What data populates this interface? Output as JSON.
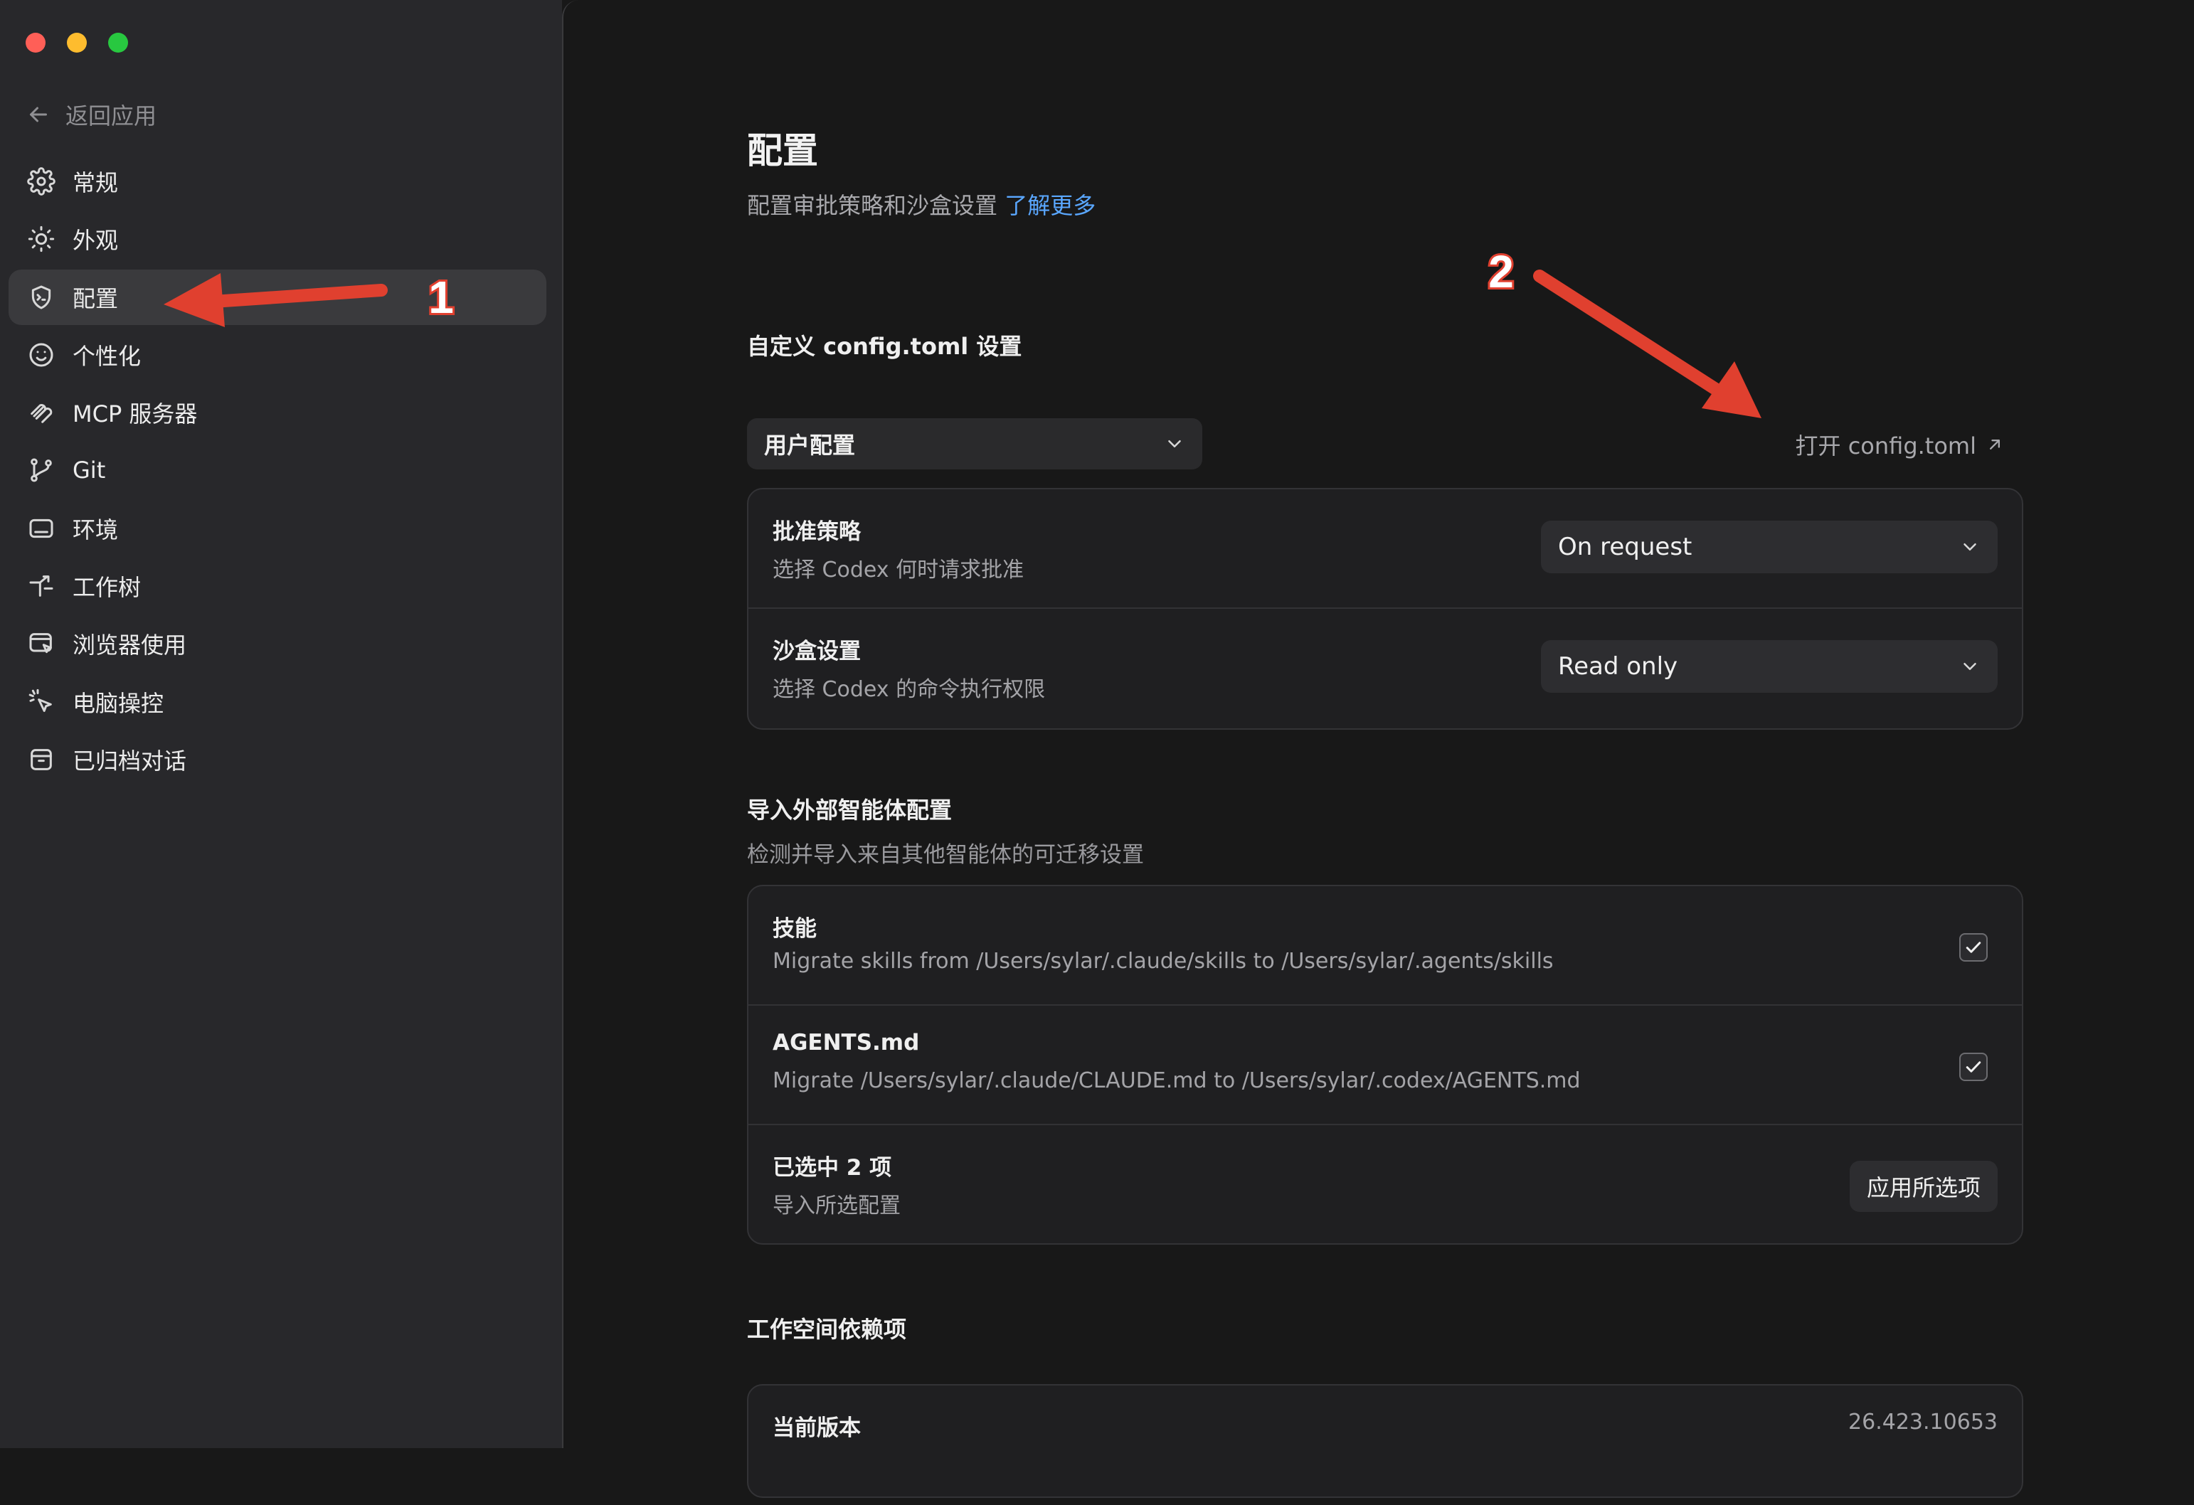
{
  "window": {
    "traffic_lights": {
      "close": "#ff5f57",
      "minimize": "#febc2e",
      "zoom": "#28c840"
    }
  },
  "sidebar": {
    "back_label": "返回应用",
    "items": [
      {
        "label": "常规",
        "icon": "gear-icon",
        "active": false
      },
      {
        "label": "外观",
        "icon": "sun-icon",
        "active": false
      },
      {
        "label": "配置",
        "icon": "shield-icon",
        "active": true
      },
      {
        "label": "个性化",
        "icon": "smile-icon",
        "active": false
      },
      {
        "label": "MCP 服务器",
        "icon": "plug-icon",
        "active": false
      },
      {
        "label": "Git",
        "icon": "git-branch-icon",
        "active": false
      },
      {
        "label": "环境",
        "icon": "monitor-icon",
        "active": false
      },
      {
        "label": "工作树",
        "icon": "worktree-icon",
        "active": false
      },
      {
        "label": "浏览器使用",
        "icon": "browser-icon",
        "active": false
      },
      {
        "label": "电脑操控",
        "icon": "cursor-click-icon",
        "active": false
      },
      {
        "label": "已归档对话",
        "icon": "archive-icon",
        "active": false
      }
    ]
  },
  "main": {
    "title": "配置",
    "subtitle": "配置审批策略和沙盒设置",
    "learn_more": "了解更多",
    "custom_section": {
      "title": "自定义 config.toml 设置",
      "profile_select": "用户配置",
      "open_config": "打开 config.toml",
      "rows": [
        {
          "title": "批准策略",
          "desc": "选择 Codex 何时请求批准",
          "value": "On request"
        },
        {
          "title": "沙盒设置",
          "desc": "选择 Codex 的命令执行权限",
          "value": "Read only"
        }
      ]
    },
    "import_section": {
      "title": "导入外部智能体配置",
      "desc": "检测并导入来自其他智能体的可迁移设置",
      "rows": [
        {
          "title": "技能",
          "desc": "Migrate skills from /Users/sylar/.claude/skills to /Users/sylar/.agents/skills",
          "checked": true
        },
        {
          "title": "AGENTS.md",
          "desc": "Migrate /Users/sylar/.claude/CLAUDE.md to /Users/sylar/.codex/AGENTS.md",
          "checked": true
        }
      ],
      "summary": {
        "title": "已选中 2 项",
        "desc": "导入所选配置",
        "button": "应用所选项"
      }
    },
    "workspace_section": {
      "title": "工作空间依赖项",
      "rows": [
        {
          "title": "当前版本",
          "value": "26.423.10653"
        }
      ]
    }
  },
  "annotations": {
    "label_1": "1",
    "label_2": "2",
    "color": "#e0402f"
  }
}
